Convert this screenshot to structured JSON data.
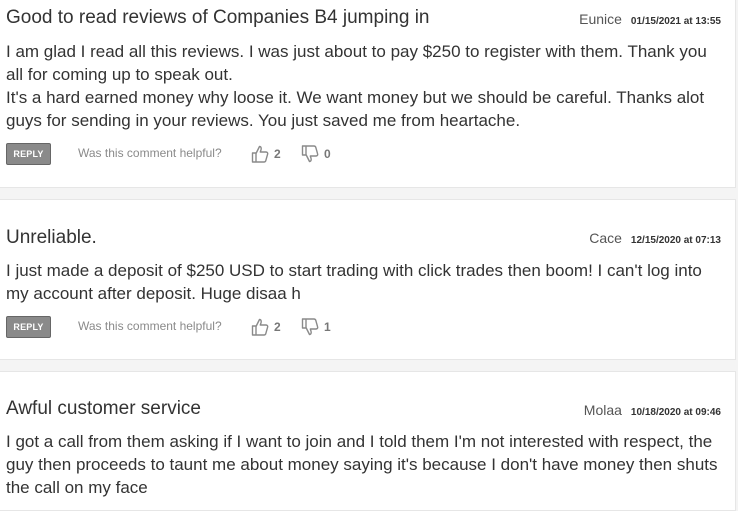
{
  "reviews": [
    {
      "title": "Good to read reviews of Companies B4 jumping in",
      "author": "Eunice",
      "date": "01/15/2021 at 13:55",
      "body": "I am glad I read all this reviews. I was just about to pay $250 to register with them. Thank you all for coming up to speak out.\nIt's a hard earned money why loose it. We want money but we should be careful. Thanks alot guys for sending in your reviews. You just saved me from heartache.",
      "reply_label": "REPLY",
      "helpful_label": "Was this comment helpful?",
      "likes": "2",
      "dislikes": "0"
    },
    {
      "title": "Unreliable.",
      "author": "Cace",
      "date": "12/15/2020 at 07:13",
      "body": "I just made a deposit of $250 USD to start trading with click trades then boom! I can't log into my account after deposit. Huge disaa h",
      "reply_label": "REPLY",
      "helpful_label": "Was this comment helpful?",
      "likes": "2",
      "dislikes": "1"
    },
    {
      "title": "Awful customer service",
      "author": "Molaa",
      "date": "10/18/2020 at 09:46",
      "body": "I got a call from them asking if I want to join and I told them I'm not interested with respect, the guy then proceeds to taunt me about money saying it's because I don't have money then shuts the call on my face",
      "reply_label": "",
      "helpful_label": "",
      "likes": "",
      "dislikes": ""
    }
  ]
}
